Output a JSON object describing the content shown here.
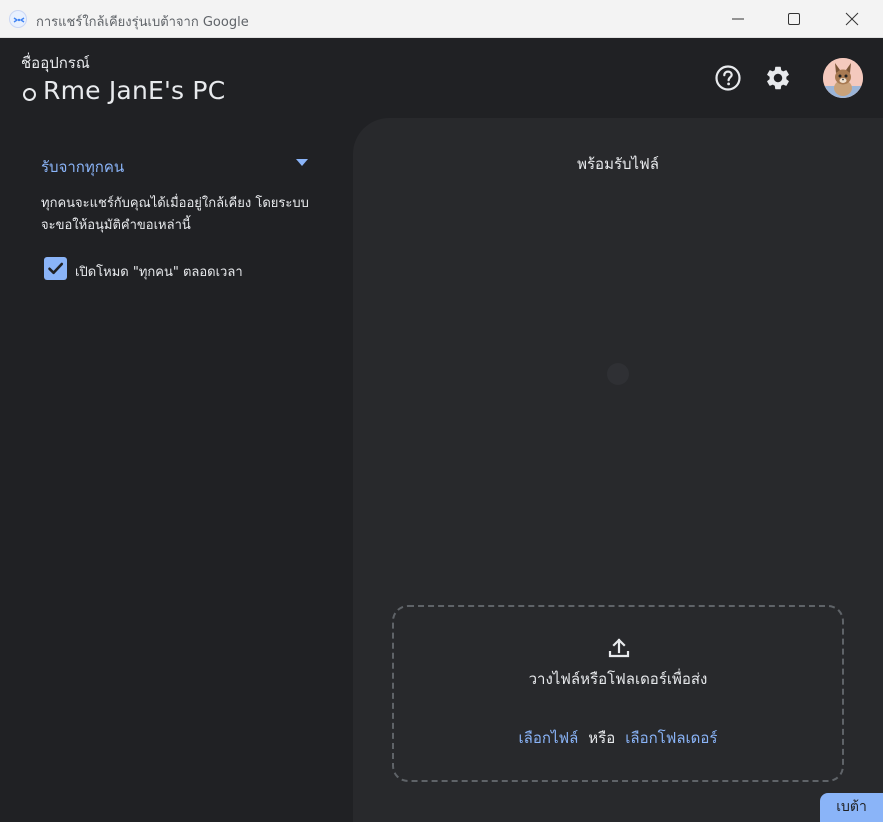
{
  "window": {
    "title": "การแชร์ใกล้เคียงรุ่นเบต้าจาก Google",
    "controls": [
      "minimize-icon",
      "maximize-icon",
      "close-icon"
    ]
  },
  "header": {
    "device_label": "ชื่ออุปกรณ์",
    "device_name": "Rme JanE's PC",
    "help_icon": "help-circle-icon",
    "settings_icon": "gear-icon"
  },
  "visibility": {
    "selected": "รับจากทุกคน",
    "description": "ทุกคนจะแชร์กับคุณได้เมื่ออยู่ใกล้เคียง โดยระบบจะขอให้อนุมัติคำขอเหล่านี้",
    "always_on_label": "เปิดโหมด \"ทุกคน\" ตลอดเวลา",
    "always_on_checked": true
  },
  "receive": {
    "status": "พร้อมรับไฟล์"
  },
  "dropzone": {
    "prompt": "วางไฟล์หรือโฟลเดอร์เพื่อส่ง",
    "choose_files": "เลือกไฟล์",
    "or": "หรือ",
    "choose_folders": "เลือกโฟลเดอร์"
  },
  "beta_badge": "เบต้า",
  "colors": {
    "accent": "#8ab4f8",
    "background": "#202124",
    "panel": "#28292c",
    "titlebar": "#f3f3f3"
  }
}
